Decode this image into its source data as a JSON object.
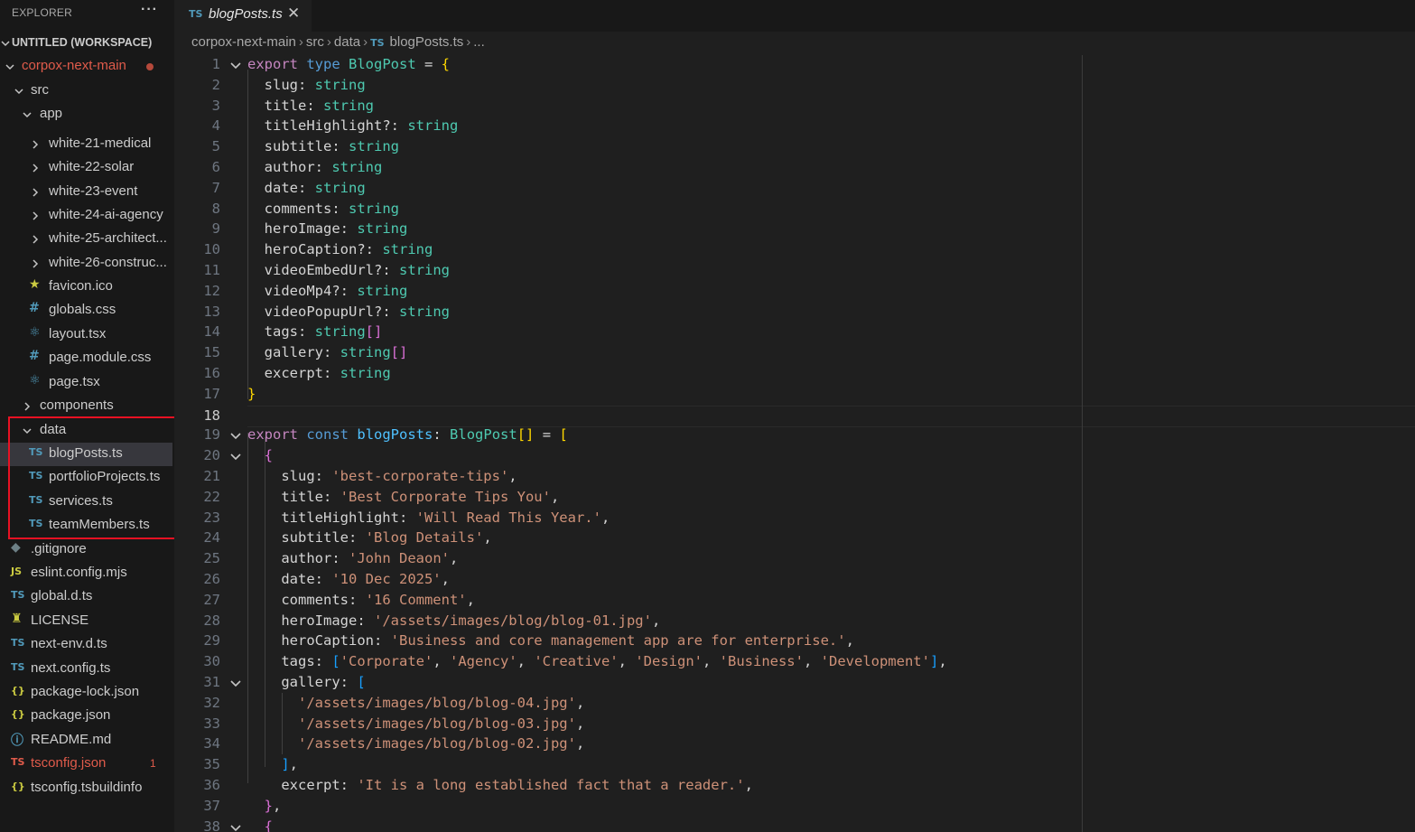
{
  "explorer": {
    "title": "EXPLORER",
    "more_icon": "···",
    "workspace": "UNTITLED (WORKSPACE)",
    "tree": [
      {
        "label": "corpox-next-main",
        "kind": "folder-open",
        "depth": 0,
        "status": "modified"
      },
      {
        "label": "src",
        "kind": "folder-open",
        "depth": 1
      },
      {
        "label": "app",
        "kind": "folder-open",
        "depth": 2
      },
      {
        "label": "white-21-medical",
        "kind": "folder",
        "depth": 3
      },
      {
        "label": "white-22-solar",
        "kind": "folder",
        "depth": 3
      },
      {
        "label": "white-23-event",
        "kind": "folder",
        "depth": 3
      },
      {
        "label": "white-24-ai-agency",
        "kind": "folder",
        "depth": 3
      },
      {
        "label": "white-25-architect...",
        "kind": "folder",
        "depth": 3
      },
      {
        "label": "white-26-construc...",
        "kind": "folder",
        "depth": 3
      },
      {
        "label": "favicon.ico",
        "kind": "file",
        "icon": "★",
        "depth": 3
      },
      {
        "label": "globals.css",
        "kind": "file",
        "icon": "#",
        "depth": 3
      },
      {
        "label": "layout.tsx",
        "kind": "file",
        "icon": "⚛",
        "depth": 3
      },
      {
        "label": "page.module.css",
        "kind": "file",
        "icon": "#",
        "depth": 3
      },
      {
        "label": "page.tsx",
        "kind": "file",
        "icon": "⚛",
        "depth": 3
      },
      {
        "label": "components",
        "kind": "folder",
        "depth": 2
      },
      {
        "label": "data",
        "kind": "folder-open",
        "depth": 2
      },
      {
        "label": "blogPosts.ts",
        "kind": "file",
        "icon": "TS",
        "depth": 3,
        "selected": true
      },
      {
        "label": "portfolioProjects.ts",
        "kind": "file",
        "icon": "TS",
        "depth": 3
      },
      {
        "label": "services.ts",
        "kind": "file",
        "icon": "TS",
        "depth": 3
      },
      {
        "label": "teamMembers.ts",
        "kind": "file",
        "icon": "TS",
        "depth": 3
      },
      {
        "label": ".gitignore",
        "kind": "file",
        "icon": "◆",
        "depth": 1
      },
      {
        "label": "eslint.config.mjs",
        "kind": "file",
        "icon": "JS",
        "depth": 1
      },
      {
        "label": "global.d.ts",
        "kind": "file",
        "icon": "TS",
        "depth": 1
      },
      {
        "label": "LICENSE",
        "kind": "file",
        "icon": "♜",
        "depth": 1
      },
      {
        "label": "next-env.d.ts",
        "kind": "file",
        "icon": "TS",
        "depth": 1
      },
      {
        "label": "next.config.ts",
        "kind": "file",
        "icon": "TS",
        "depth": 1
      },
      {
        "label": "package-lock.json",
        "kind": "file",
        "icon": "{}",
        "depth": 1
      },
      {
        "label": "package.json",
        "kind": "file",
        "icon": "{}",
        "depth": 1
      },
      {
        "label": "README.md",
        "kind": "file",
        "icon": "ⓘ",
        "depth": 1
      },
      {
        "label": "tsconfig.json",
        "kind": "file",
        "icon": "TS",
        "depth": 1,
        "error_count": "1"
      },
      {
        "label": "tsconfig.tsbuildinfo",
        "kind": "file",
        "icon": "{}",
        "depth": 1
      }
    ]
  },
  "tab": {
    "icon": "TS",
    "label": "blogPosts.ts",
    "close_icon": "✕"
  },
  "breadcrumb": [
    "corpox-next-main",
    "src",
    "data",
    "blogPosts.ts",
    "..."
  ],
  "editor": {
    "lines": [
      {
        "n": "1",
        "fold": "open",
        "tokens": [
          [
            "kw2",
            "export"
          ],
          [
            "pn",
            " "
          ],
          [
            "kw",
            "type"
          ],
          [
            "pn",
            " "
          ],
          [
            "ty",
            "BlogPost"
          ],
          [
            "pn",
            " = "
          ],
          [
            "br1",
            "{"
          ]
        ]
      },
      {
        "n": "2",
        "tokens": [
          [
            "pn",
            "  "
          ],
          [
            "pr",
            "slug"
          ],
          [
            "pn",
            ": "
          ],
          [
            "ty",
            "string"
          ]
        ]
      },
      {
        "n": "3",
        "tokens": [
          [
            "pn",
            "  "
          ],
          [
            "pr",
            "title"
          ],
          [
            "pn",
            ": "
          ],
          [
            "ty",
            "string"
          ]
        ]
      },
      {
        "n": "4",
        "tokens": [
          [
            "pn",
            "  "
          ],
          [
            "pr",
            "titleHighlight"
          ],
          [
            "pn",
            "?: "
          ],
          [
            "ty",
            "string"
          ]
        ]
      },
      {
        "n": "5",
        "tokens": [
          [
            "pn",
            "  "
          ],
          [
            "pr",
            "subtitle"
          ],
          [
            "pn",
            ": "
          ],
          [
            "ty",
            "string"
          ]
        ]
      },
      {
        "n": "6",
        "tokens": [
          [
            "pn",
            "  "
          ],
          [
            "pr",
            "author"
          ],
          [
            "pn",
            ": "
          ],
          [
            "ty",
            "string"
          ]
        ]
      },
      {
        "n": "7",
        "tokens": [
          [
            "pn",
            "  "
          ],
          [
            "pr",
            "date"
          ],
          [
            "pn",
            ": "
          ],
          [
            "ty",
            "string"
          ]
        ]
      },
      {
        "n": "8",
        "tokens": [
          [
            "pn",
            "  "
          ],
          [
            "pr",
            "comments"
          ],
          [
            "pn",
            ": "
          ],
          [
            "ty",
            "string"
          ]
        ]
      },
      {
        "n": "9",
        "tokens": [
          [
            "pn",
            "  "
          ],
          [
            "pr",
            "heroImage"
          ],
          [
            "pn",
            ": "
          ],
          [
            "ty",
            "string"
          ]
        ]
      },
      {
        "n": "10",
        "tokens": [
          [
            "pn",
            "  "
          ],
          [
            "pr",
            "heroCaption"
          ],
          [
            "pn",
            "?: "
          ],
          [
            "ty",
            "string"
          ]
        ]
      },
      {
        "n": "11",
        "tokens": [
          [
            "pn",
            "  "
          ],
          [
            "pr",
            "videoEmbedUrl"
          ],
          [
            "pn",
            "?: "
          ],
          [
            "ty",
            "string"
          ]
        ]
      },
      {
        "n": "12",
        "tokens": [
          [
            "pn",
            "  "
          ],
          [
            "pr",
            "videoMp4"
          ],
          [
            "pn",
            "?: "
          ],
          [
            "ty",
            "string"
          ]
        ]
      },
      {
        "n": "13",
        "tokens": [
          [
            "pn",
            "  "
          ],
          [
            "pr",
            "videoPopupUrl"
          ],
          [
            "pn",
            "?: "
          ],
          [
            "ty",
            "string"
          ]
        ]
      },
      {
        "n": "14",
        "tokens": [
          [
            "pn",
            "  "
          ],
          [
            "pr",
            "tags"
          ],
          [
            "pn",
            ": "
          ],
          [
            "ty",
            "string"
          ],
          [
            "br2",
            "[]"
          ]
        ]
      },
      {
        "n": "15",
        "tokens": [
          [
            "pn",
            "  "
          ],
          [
            "pr",
            "gallery"
          ],
          [
            "pn",
            ": "
          ],
          [
            "ty",
            "string"
          ],
          [
            "br2",
            "[]"
          ]
        ]
      },
      {
        "n": "16",
        "tokens": [
          [
            "pn",
            "  "
          ],
          [
            "pr",
            "excerpt"
          ],
          [
            "pn",
            ": "
          ],
          [
            "ty",
            "string"
          ]
        ]
      },
      {
        "n": "17",
        "tokens": [
          [
            "br1",
            "}"
          ]
        ]
      },
      {
        "n": "18",
        "current": true,
        "tokens": []
      },
      {
        "n": "19",
        "fold": "open",
        "tokens": [
          [
            "kw2",
            "export"
          ],
          [
            "pn",
            " "
          ],
          [
            "kw",
            "const"
          ],
          [
            "pn",
            " "
          ],
          [
            "vr",
            "blogPosts"
          ],
          [
            "pn",
            ": "
          ],
          [
            "ty",
            "BlogPost"
          ],
          [
            "br1",
            "[]"
          ],
          [
            "pn",
            " = "
          ],
          [
            "br1",
            "["
          ]
        ]
      },
      {
        "n": "20",
        "fold": "open",
        "tokens": [
          [
            "pn",
            "  "
          ],
          [
            "br2",
            "{"
          ]
        ]
      },
      {
        "n": "21",
        "tokens": [
          [
            "pn",
            "    "
          ],
          [
            "pr",
            "slug"
          ],
          [
            "pn",
            ": "
          ],
          [
            "st",
            "'best-corporate-tips'"
          ],
          [
            "pn",
            ","
          ]
        ]
      },
      {
        "n": "22",
        "tokens": [
          [
            "pn",
            "    "
          ],
          [
            "pr",
            "title"
          ],
          [
            "pn",
            ": "
          ],
          [
            "st",
            "'Best Corporate Tips You'"
          ],
          [
            "pn",
            ","
          ]
        ]
      },
      {
        "n": "23",
        "tokens": [
          [
            "pn",
            "    "
          ],
          [
            "pr",
            "titleHighlight"
          ],
          [
            "pn",
            ": "
          ],
          [
            "st",
            "'Will Read This Year.'"
          ],
          [
            "pn",
            ","
          ]
        ]
      },
      {
        "n": "24",
        "tokens": [
          [
            "pn",
            "    "
          ],
          [
            "pr",
            "subtitle"
          ],
          [
            "pn",
            ": "
          ],
          [
            "st",
            "'Blog Details'"
          ],
          [
            "pn",
            ","
          ]
        ]
      },
      {
        "n": "25",
        "tokens": [
          [
            "pn",
            "    "
          ],
          [
            "pr",
            "author"
          ],
          [
            "pn",
            ": "
          ],
          [
            "st",
            "'John Deaon'"
          ],
          [
            "pn",
            ","
          ]
        ]
      },
      {
        "n": "26",
        "tokens": [
          [
            "pn",
            "    "
          ],
          [
            "pr",
            "date"
          ],
          [
            "pn",
            ": "
          ],
          [
            "st",
            "'10 Dec 2025'"
          ],
          [
            "pn",
            ","
          ]
        ]
      },
      {
        "n": "27",
        "tokens": [
          [
            "pn",
            "    "
          ],
          [
            "pr",
            "comments"
          ],
          [
            "pn",
            ": "
          ],
          [
            "st",
            "'16 Comment'"
          ],
          [
            "pn",
            ","
          ]
        ]
      },
      {
        "n": "28",
        "tokens": [
          [
            "pn",
            "    "
          ],
          [
            "pr",
            "heroImage"
          ],
          [
            "pn",
            ": "
          ],
          [
            "st",
            "'/assets/images/blog/blog-01.jpg'"
          ],
          [
            "pn",
            ","
          ]
        ]
      },
      {
        "n": "29",
        "tokens": [
          [
            "pn",
            "    "
          ],
          [
            "pr",
            "heroCaption"
          ],
          [
            "pn",
            ": "
          ],
          [
            "st",
            "'Business and core management app are for enterprise.'"
          ],
          [
            "pn",
            ","
          ]
        ]
      },
      {
        "n": "30",
        "tokens": [
          [
            "pn",
            "    "
          ],
          [
            "pr",
            "tags"
          ],
          [
            "pn",
            ": "
          ],
          [
            "br3",
            "["
          ],
          [
            "st",
            "'Corporate'"
          ],
          [
            "pn",
            ", "
          ],
          [
            "st",
            "'Agency'"
          ],
          [
            "pn",
            ", "
          ],
          [
            "st",
            "'Creative'"
          ],
          [
            "pn",
            ", "
          ],
          [
            "st",
            "'Design'"
          ],
          [
            "pn",
            ", "
          ],
          [
            "st",
            "'Business'"
          ],
          [
            "pn",
            ", "
          ],
          [
            "st",
            "'Development'"
          ],
          [
            "br3",
            "]"
          ],
          [
            "pn",
            ","
          ]
        ]
      },
      {
        "n": "31",
        "fold": "open",
        "tokens": [
          [
            "pn",
            "    "
          ],
          [
            "pr",
            "gallery"
          ],
          [
            "pn",
            ": "
          ],
          [
            "br3",
            "["
          ]
        ]
      },
      {
        "n": "32",
        "tokens": [
          [
            "pn",
            "      "
          ],
          [
            "st",
            "'/assets/images/blog/blog-04.jpg'"
          ],
          [
            "pn",
            ","
          ]
        ]
      },
      {
        "n": "33",
        "tokens": [
          [
            "pn",
            "      "
          ],
          [
            "st",
            "'/assets/images/blog/blog-03.jpg'"
          ],
          [
            "pn",
            ","
          ]
        ]
      },
      {
        "n": "34",
        "tokens": [
          [
            "pn",
            "      "
          ],
          [
            "st",
            "'/assets/images/blog/blog-02.jpg'"
          ],
          [
            "pn",
            ","
          ]
        ]
      },
      {
        "n": "35",
        "tokens": [
          [
            "pn",
            "    "
          ],
          [
            "br3",
            "]"
          ],
          [
            "pn",
            ","
          ]
        ]
      },
      {
        "n": "36",
        "tokens": [
          [
            "pn",
            "    "
          ],
          [
            "pr",
            "excerpt"
          ],
          [
            "pn",
            ": "
          ],
          [
            "st",
            "'It is a long established fact that a reader.'"
          ],
          [
            "pn",
            ","
          ]
        ]
      },
      {
        "n": "37",
        "tokens": [
          [
            "pn",
            "  "
          ],
          [
            "br2",
            "}"
          ],
          [
            "pn",
            ","
          ]
        ]
      },
      {
        "n": "38",
        "fold": "open",
        "tokens": [
          [
            "pn",
            "  "
          ],
          [
            "br2",
            "{"
          ]
        ]
      }
    ]
  }
}
